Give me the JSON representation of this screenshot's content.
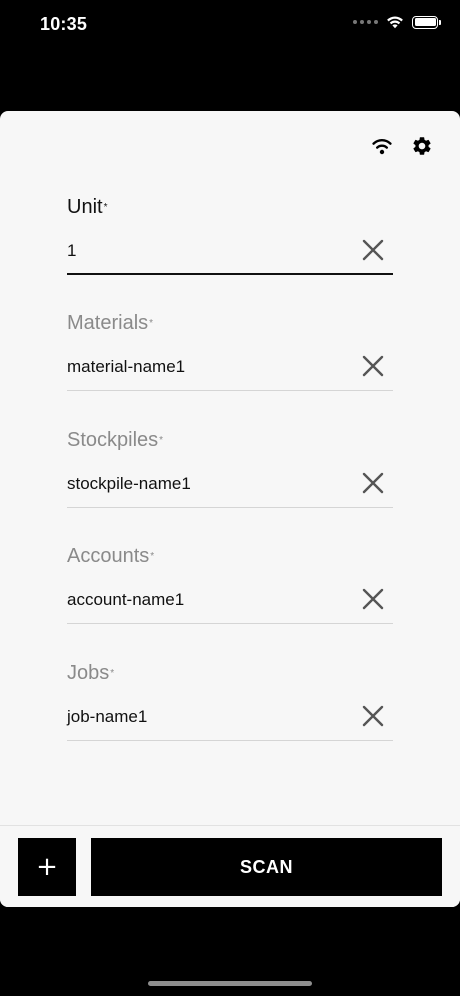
{
  "status_bar": {
    "time": "10:35"
  },
  "icons": {
    "wifi": "wifi-icon",
    "settings": "gear-icon",
    "clear": "close-icon",
    "add": "plus-icon"
  },
  "colors": {
    "background": "#f7f7f7",
    "button": "#000000",
    "active_label": "#111111",
    "inactive_label": "#8a8a8a"
  },
  "form": {
    "unit": {
      "label": "Unit",
      "required_mark": "*",
      "value": "1"
    },
    "materials": {
      "label": "Materials",
      "required_mark": "*",
      "value": "material-name1"
    },
    "stockpiles": {
      "label": "Stockpiles",
      "required_mark": "*",
      "value": "stockpile-name1"
    },
    "accounts": {
      "label": "Accounts",
      "required_mark": "*",
      "value": "account-name1"
    },
    "jobs": {
      "label": "Jobs",
      "required_mark": "*",
      "value": "job-name1"
    }
  },
  "actions": {
    "add_label": "+",
    "scan_label": "SCAN"
  }
}
